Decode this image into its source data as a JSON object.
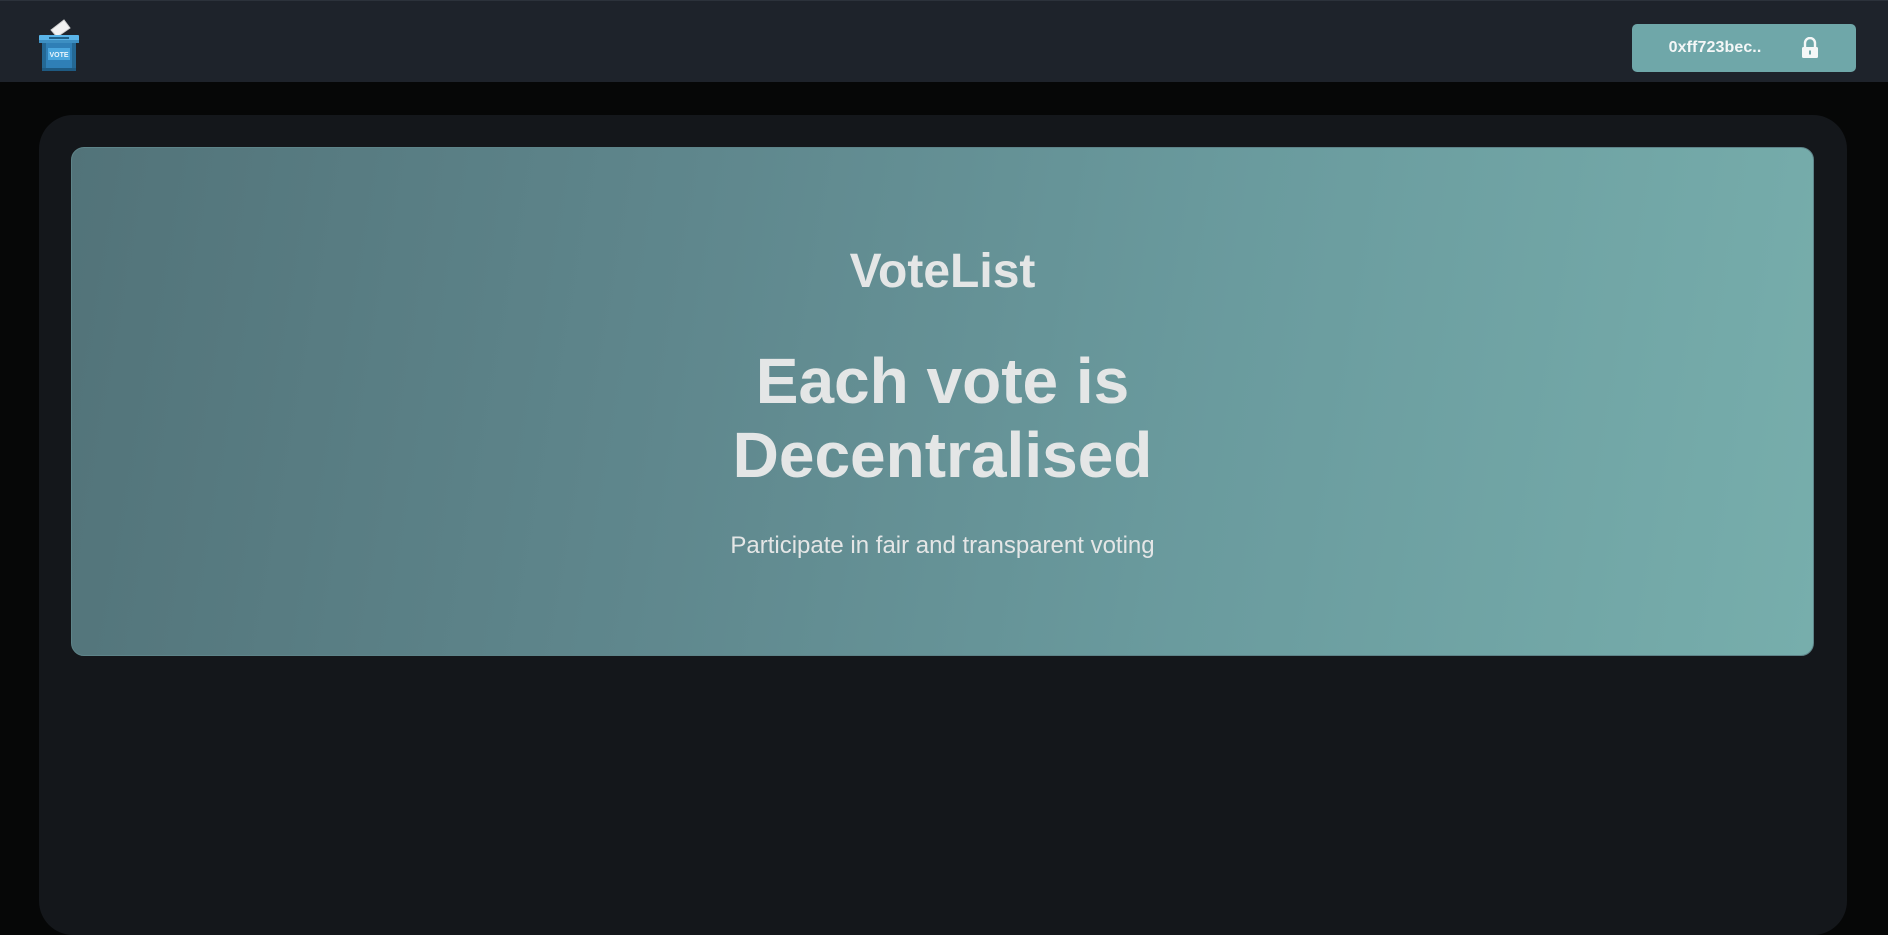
{
  "header": {
    "logo_icon": "ballot-box-icon",
    "logo_text": "VOTE",
    "wallet": {
      "address": "0xff723bec..",
      "icon": "lock-icon"
    }
  },
  "hero": {
    "title": "VoteList",
    "headline_line1": "Each vote is",
    "headline_line2": "Decentralised",
    "subtitle": "Participate in fair and transparent voting"
  },
  "colors": {
    "header_bg": "#1e232b",
    "page_bg": "#060707",
    "panel_bg": "#14171b",
    "accent": "#6fa7a9",
    "hero_gradient_start": "#527379",
    "hero_gradient_end": "#77aeac"
  }
}
